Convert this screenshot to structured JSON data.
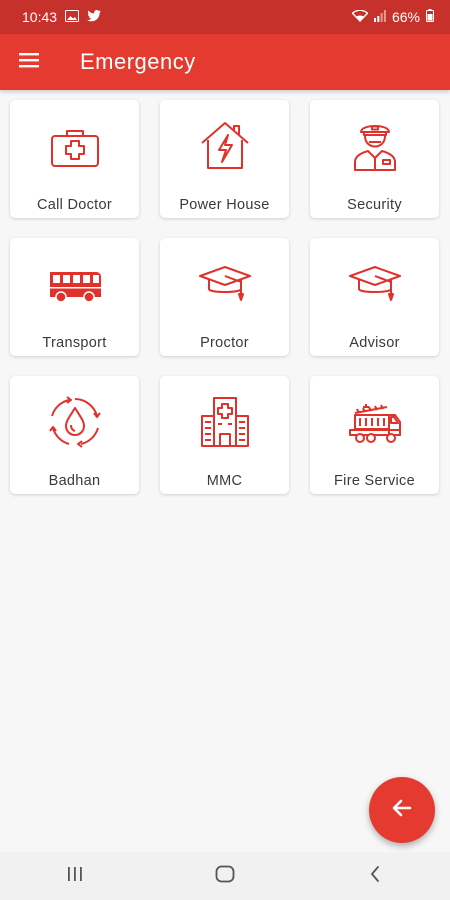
{
  "status_bar": {
    "time": "10:43",
    "battery": "66%"
  },
  "app_bar": {
    "title": "Emergency"
  },
  "cards": [
    {
      "label": "Call Doctor",
      "icon": "first-aid-kit-icon"
    },
    {
      "label": "Power House",
      "icon": "power-house-icon"
    },
    {
      "label": "Security",
      "icon": "security-guard-icon"
    },
    {
      "label": "Transport",
      "icon": "bus-icon"
    },
    {
      "label": "Proctor",
      "icon": "graduation-cap-icon"
    },
    {
      "label": "Advisor",
      "icon": "graduation-cap-icon"
    },
    {
      "label": "Badhan",
      "icon": "blood-drop-icon"
    },
    {
      "label": "MMC",
      "icon": "hospital-icon"
    },
    {
      "label": "Fire Service",
      "icon": "fire-truck-icon"
    }
  ],
  "colors": {
    "primary": "#e53a2f",
    "status_bar": "#c6322b",
    "icon": "#e0322b"
  }
}
